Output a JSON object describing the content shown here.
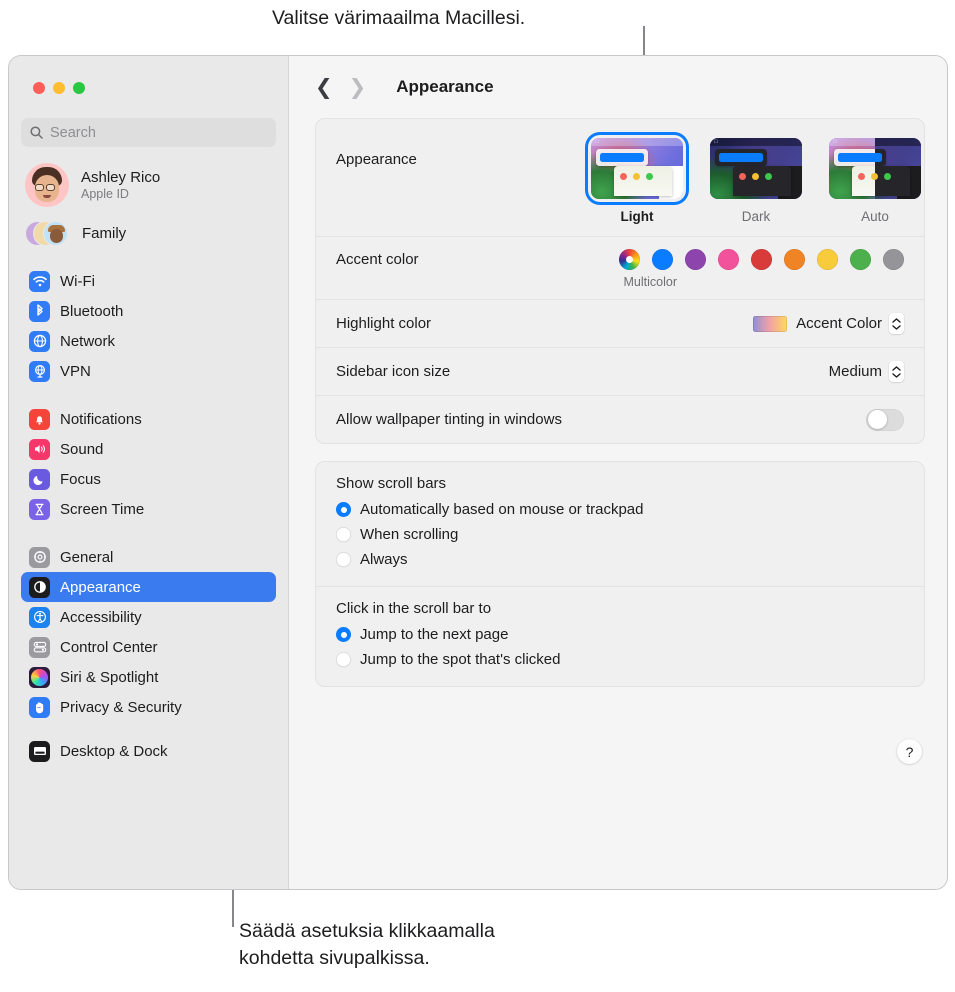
{
  "callouts": {
    "top": "Valitse värimaailma Macillesi.",
    "bottom": "Säädä asetuksia klikkaamalla\nkohdetta sivupalkissa."
  },
  "window": {
    "traffic_lights": [
      "close",
      "minimize",
      "zoom"
    ]
  },
  "sidebar": {
    "search": {
      "placeholder": "Search",
      "value": ""
    },
    "profile": {
      "name": "Ashley Rico",
      "subtitle": "Apple ID"
    },
    "family": {
      "label": "Family"
    },
    "groups": [
      {
        "items": [
          {
            "label": "Wi-Fi",
            "icon": "wifi-icon",
            "color": "#2f7cf6"
          },
          {
            "label": "Bluetooth",
            "icon": "bluetooth-icon",
            "color": "#2f7cf6"
          },
          {
            "label": "Network",
            "icon": "globe-icon",
            "color": "#2f7cf6"
          },
          {
            "label": "VPN",
            "icon": "vpn-globe-icon",
            "color": "#2f7cf6"
          }
        ]
      },
      {
        "items": [
          {
            "label": "Notifications",
            "icon": "bell-icon",
            "color": "#f5443a"
          },
          {
            "label": "Sound",
            "icon": "speaker-icon",
            "color": "#f5376a"
          },
          {
            "label": "Focus",
            "icon": "moon-icon",
            "color": "#6a5ae0"
          },
          {
            "label": "Screen Time",
            "icon": "hourglass-icon",
            "color": "#7b63e8"
          }
        ]
      },
      {
        "items": [
          {
            "label": "General",
            "icon": "gear-icon",
            "color": "#9a9a9f"
          },
          {
            "label": "Appearance",
            "icon": "appearance-icon",
            "color": "#1c1c1e",
            "selected": true
          },
          {
            "label": "Accessibility",
            "icon": "accessibility-icon",
            "color": "#1b82f0"
          },
          {
            "label": "Control Center",
            "icon": "control-center-icon",
            "color": "#9a9a9f"
          },
          {
            "label": "Siri & Spotlight",
            "icon": "siri-icon",
            "color": "#2b1b3d"
          },
          {
            "label": "Privacy & Security",
            "icon": "hand-icon",
            "color": "#2f7cf6"
          }
        ]
      },
      {
        "items": [
          {
            "label": "Desktop & Dock",
            "icon": "desktop-dock-icon",
            "color": "#1c1c1e"
          }
        ]
      }
    ]
  },
  "toolbar": {
    "back_icon": "chevron-left-icon",
    "forward_icon": "chevron-right-icon",
    "title": "Appearance"
  },
  "main": {
    "appearance": {
      "label": "Appearance",
      "options": [
        {
          "name": "Light",
          "selected": true
        },
        {
          "name": "Dark",
          "selected": false
        },
        {
          "name": "Auto",
          "selected": false
        }
      ]
    },
    "accent": {
      "label": "Accent color",
      "caption": "Multicolor",
      "swatches": [
        {
          "name": "Multicolor",
          "color": "multicolor",
          "selected": true
        },
        {
          "name": "Blue",
          "color": "#0a7cff"
        },
        {
          "name": "Purple",
          "color": "#8e44ad"
        },
        {
          "name": "Pink",
          "color": "#f2529b"
        },
        {
          "name": "Red",
          "color": "#d93a3a"
        },
        {
          "name": "Orange",
          "color": "#f08424"
        },
        {
          "name": "Yellow",
          "color": "#f7cb3a"
        },
        {
          "name": "Green",
          "color": "#4cb04c"
        },
        {
          "name": "Graphite",
          "color": "#949499"
        }
      ]
    },
    "highlight": {
      "label": "Highlight color",
      "value": "Accent Color"
    },
    "sidebar_icon_size": {
      "label": "Sidebar icon size",
      "value": "Medium"
    },
    "wallpaper_tinting": {
      "label": "Allow wallpaper tinting in windows",
      "enabled": false
    },
    "scroll_bars": {
      "title": "Show scroll bars",
      "options": [
        {
          "label": "Automatically based on mouse or trackpad",
          "selected": true
        },
        {
          "label": "When scrolling",
          "selected": false
        },
        {
          "label": "Always",
          "selected": false
        }
      ]
    },
    "scroll_click": {
      "title": "Click in the scroll bar to",
      "options": [
        {
          "label": "Jump to the next page",
          "selected": true
        },
        {
          "label": "Jump to the spot that's clicked",
          "selected": false
        }
      ]
    },
    "help": {
      "label": "?"
    }
  }
}
